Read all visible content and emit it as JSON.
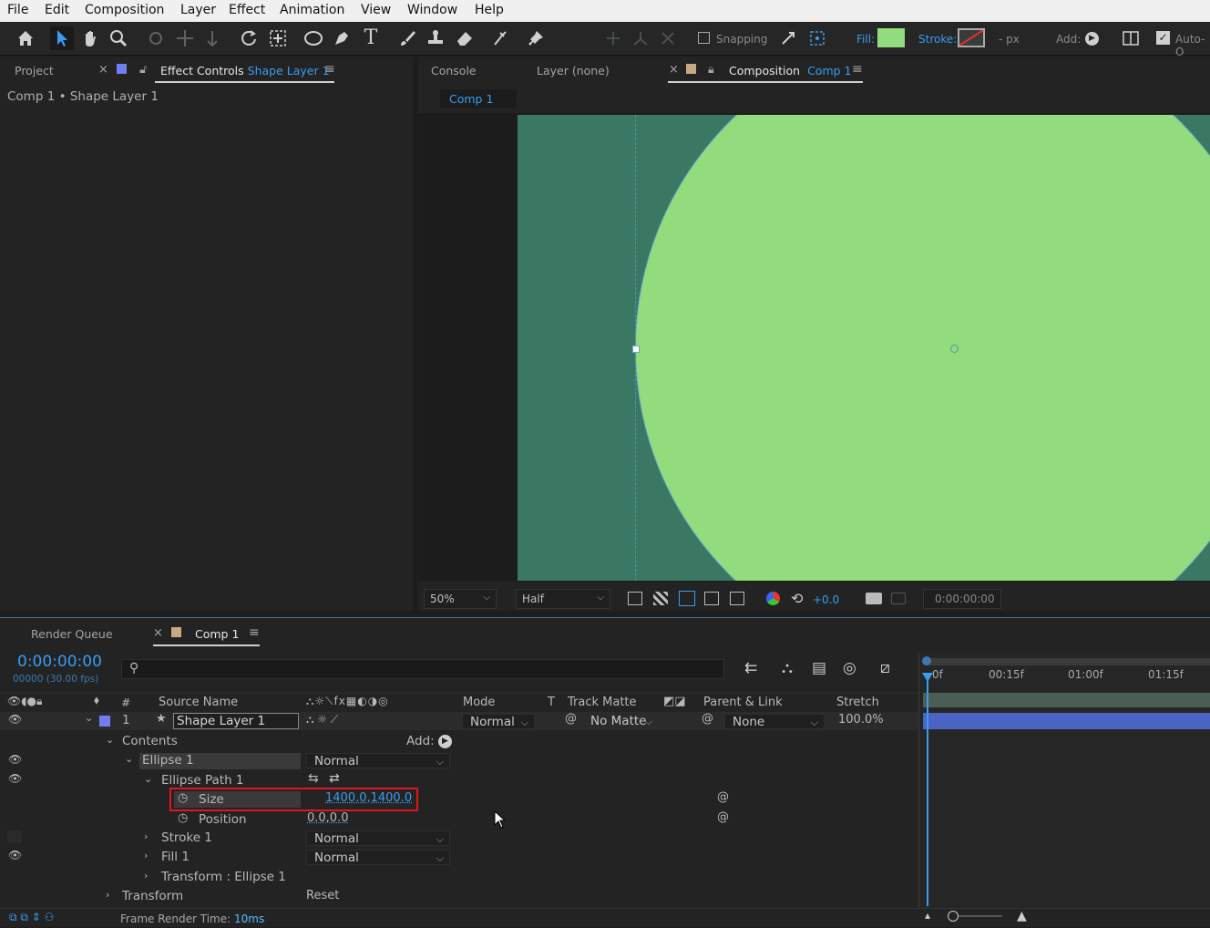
{
  "menu": [
    "File",
    "Edit",
    "Composition",
    "Layer",
    "Effect",
    "Animation",
    "View",
    "Window",
    "Help"
  ],
  "toolbar": {
    "snapping": "Snapping",
    "fill_label": "Fill:",
    "stroke_label": "Stroke:",
    "px_label": "- px",
    "add_label": "Add:",
    "auto_label": "Auto-O",
    "fill_color": "#93dc7d"
  },
  "left_panel": {
    "project_tab": "Project",
    "effect_tab_prefix": "Effect Controls",
    "effect_tab_layer": "Shape Layer 1",
    "breadcrumb": "Comp 1 • Shape Layer 1"
  },
  "comp_panel": {
    "console_tab": "Console",
    "layer_tab": "Layer (none)",
    "composition_tab_prefix": "Composition",
    "composition_tab_comp": "Comp 1",
    "subtab": "Comp 1",
    "zoom": "50%",
    "resolution": "Half",
    "exposure": "+0.0",
    "timecode": "0:00:00:00",
    "bg_color": "#3a7863",
    "circle_color": "#93dc7d"
  },
  "timeline": {
    "render_queue_tab": "Render Queue",
    "comp_tab": "Comp 1",
    "current_time": "0:00:00:00",
    "frame_info": "00000 (30.00 fps)",
    "columns": {
      "num": "#",
      "source_name": "Source Name",
      "mode": "Mode",
      "t": "T",
      "track_matte": "Track Matte",
      "parent_link": "Parent & Link",
      "stretch": "Stretch"
    },
    "layer": {
      "index": "1",
      "name": "Shape Layer 1",
      "mode": "Normal",
      "track_matte": "No Matte",
      "parent": "None",
      "stretch": "100.0%"
    },
    "contents_label": "Contents",
    "add_label": "Add:",
    "ellipse_group": "Ellipse 1",
    "ellipse_mode": "Normal",
    "ellipse_path": "Ellipse Path 1",
    "size_label": "Size",
    "size_value": "1400.0,1400.0",
    "position_label": "Position",
    "position_value": "0.0,0.0",
    "stroke_label": "Stroke 1",
    "stroke_mode": "Normal",
    "fill_label": "Fill 1",
    "fill_mode": "Normal",
    "transform_ellipse": "Transform : Ellipse 1",
    "transform_label": "Transform",
    "reset_label": "Reset",
    "ruler": [
      "0f",
      "00:15f",
      "01:00f",
      "01:15f"
    ],
    "frame_render_label": "Frame Render Time:",
    "frame_render_value": "10ms"
  }
}
